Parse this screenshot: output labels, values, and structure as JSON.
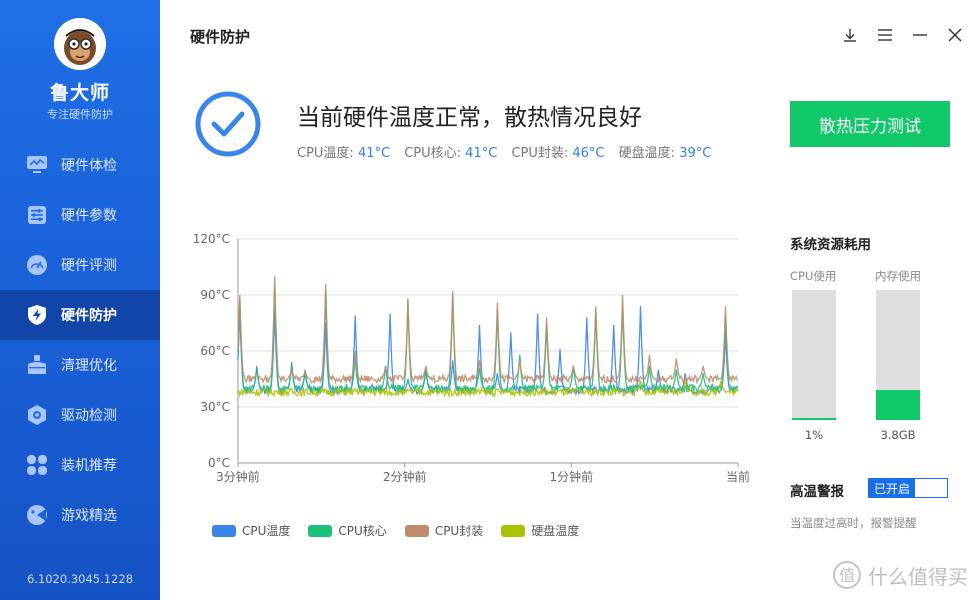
{
  "app": {
    "name": "鲁大师",
    "tagline": "专注硬件防护",
    "version": "6.1020.3045.1228"
  },
  "sidebar": {
    "items": [
      {
        "label": "硬件体检",
        "icon": "monitor-icon",
        "active": false
      },
      {
        "label": "硬件参数",
        "icon": "sliders-icon",
        "active": false
      },
      {
        "label": "硬件评测",
        "icon": "gauge-icon",
        "active": false
      },
      {
        "label": "硬件防护",
        "icon": "shield-bolt-icon",
        "active": true
      },
      {
        "label": "清理优化",
        "icon": "broom-icon",
        "active": false
      },
      {
        "label": "驱动检测",
        "icon": "gear-hex-icon",
        "active": false
      },
      {
        "label": "装机推荐",
        "icon": "grid-petals-icon",
        "active": false
      },
      {
        "label": "游戏精选",
        "icon": "gamepad-icon",
        "active": false
      }
    ]
  },
  "header": {
    "title": "硬件防护"
  },
  "window_controls": [
    "download-icon",
    "menu-icon",
    "minimize-icon",
    "close-icon"
  ],
  "status": {
    "title": "当前硬件温度正常，散热情况良好",
    "readings": [
      {
        "label": "CPU温度:",
        "value": "41°C"
      },
      {
        "label": "CPU核心:",
        "value": "41°C"
      },
      {
        "label": "CPU封装:",
        "value": "46°C"
      },
      {
        "label": "硬盘温度:",
        "value": "39°C"
      }
    ],
    "button_label": "散热压力测试"
  },
  "chart_data": {
    "type": "line",
    "y_ticks": [
      "120°C",
      "90°C",
      "60°C",
      "30°C",
      "0°C"
    ],
    "ylim": [
      0,
      120
    ],
    "x_ticks": [
      "3分钟前",
      "2分钟前",
      "1分钟前",
      "当前"
    ],
    "series": [
      {
        "name": "CPU温度",
        "color": "#3a86e8",
        "base": 39,
        "spikes": [
          [
            2,
            84
          ],
          [
            21,
            52
          ],
          [
            41,
            82
          ],
          [
            60,
            54
          ],
          [
            75,
            50
          ],
          [
            98,
            75
          ],
          [
            131,
            79
          ],
          [
            150,
            42
          ],
          [
            170,
            80
          ],
          [
            190,
            45
          ],
          [
            210,
            50
          ],
          [
            240,
            55
          ],
          [
            270,
            74
          ],
          [
            290,
            48
          ],
          [
            305,
            70
          ],
          [
            335,
            80
          ],
          [
            360,
            61
          ],
          [
            390,
            78
          ],
          [
            420,
            74
          ],
          [
            450,
            84
          ],
          [
            470,
            50
          ],
          [
            500,
            48
          ],
          [
            530,
            42
          ],
          [
            545,
            70
          ]
        ]
      },
      {
        "name": "CPU核心",
        "color": "#1dbf7a",
        "base": 40,
        "spikes": [
          [
            2,
            88
          ],
          [
            21,
            50
          ],
          [
            41,
            96
          ],
          [
            60,
            52
          ],
          [
            75,
            48
          ],
          [
            98,
            93
          ],
          [
            131,
            56
          ],
          [
            165,
            52
          ],
          [
            190,
            88
          ],
          [
            210,
            50
          ],
          [
            240,
            90
          ],
          [
            270,
            51
          ],
          [
            290,
            82
          ],
          [
            315,
            58
          ],
          [
            345,
            75
          ],
          [
            375,
            52
          ],
          [
            400,
            82
          ],
          [
            430,
            85
          ],
          [
            460,
            52
          ],
          [
            490,
            50
          ],
          [
            520,
            48
          ],
          [
            545,
            80
          ]
        ]
      },
      {
        "name": "CPU封装",
        "color": "#c08b6a",
        "base": 45,
        "spikes": [
          [
            2,
            90
          ],
          [
            21,
            48
          ],
          [
            41,
            100
          ],
          [
            60,
            50
          ],
          [
            75,
            49
          ],
          [
            98,
            96
          ],
          [
            131,
            60
          ],
          [
            165,
            52
          ],
          [
            190,
            88
          ],
          [
            210,
            52
          ],
          [
            240,
            92
          ],
          [
            270,
            55
          ],
          [
            290,
            86
          ],
          [
            315,
            55
          ],
          [
            345,
            78
          ],
          [
            375,
            52
          ],
          [
            400,
            84
          ],
          [
            430,
            90
          ],
          [
            460,
            58
          ],
          [
            490,
            56
          ],
          [
            520,
            52
          ],
          [
            545,
            84
          ]
        ]
      },
      {
        "name": "硬盘温度",
        "color": "#a9c300",
        "base": 38,
        "spikes": [
          [
            450,
            44
          ],
          [
            500,
            44
          ],
          [
            540,
            44
          ]
        ]
      }
    ]
  },
  "resources": {
    "title": "系统资源耗用",
    "cpu": {
      "label": "CPU使用",
      "value": "1%",
      "level": 0.01
    },
    "mem": {
      "label": "内存使用",
      "value": "3.8GB",
      "level": 0.23
    }
  },
  "alarm": {
    "label": "高温警报",
    "toggle_text": "已开启",
    "desc": "当温度过高时，报警提醒"
  },
  "watermark": {
    "text": "什么值得买"
  }
}
